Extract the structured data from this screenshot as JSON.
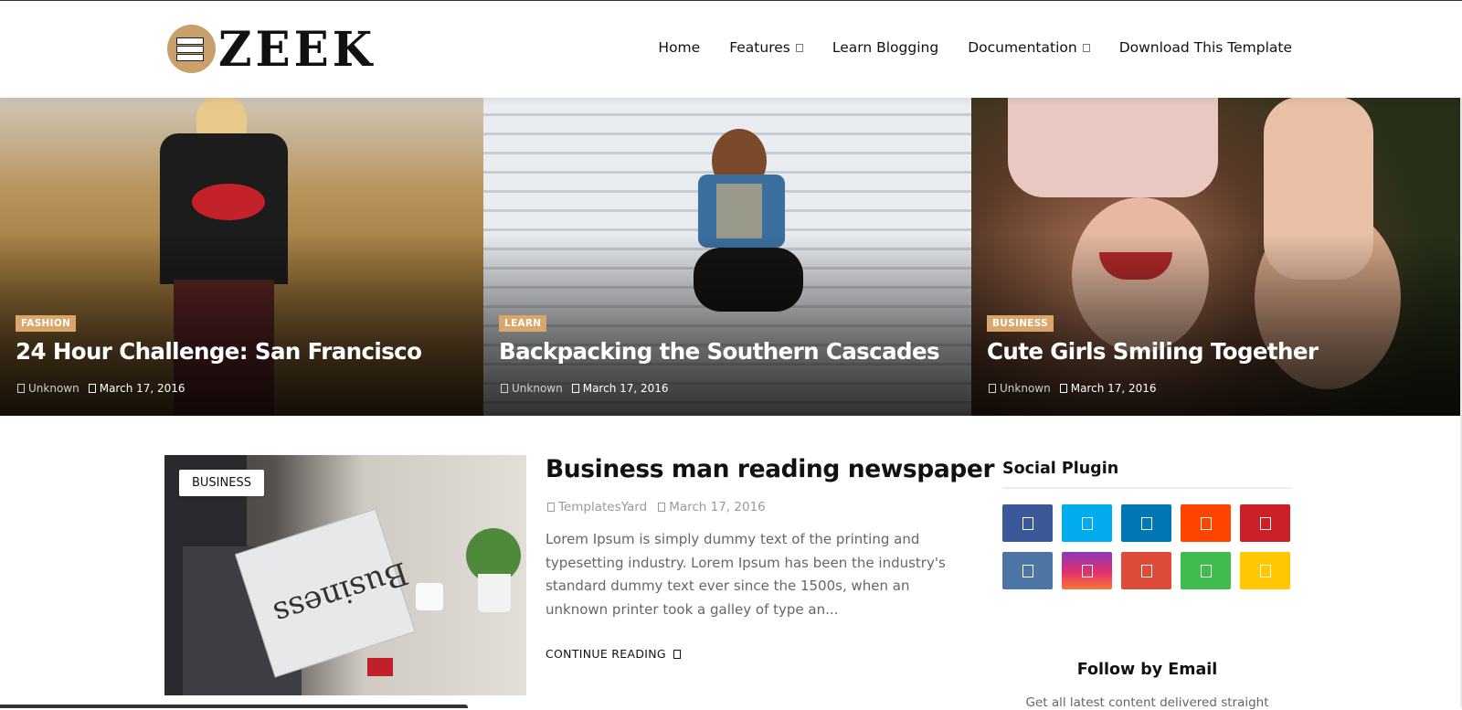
{
  "header": {
    "logo_text": "ZEEK",
    "nav": [
      {
        "label": "Home",
        "has_dropdown": false
      },
      {
        "label": "Features",
        "has_dropdown": true
      },
      {
        "label": "Learn Blogging",
        "has_dropdown": false
      },
      {
        "label": "Documentation",
        "has_dropdown": true
      },
      {
        "label": "Download This Template",
        "has_dropdown": false
      }
    ]
  },
  "hero": [
    {
      "category": "FASHION",
      "title": "24 Hour Challenge: San Francisco",
      "author": "Unknown",
      "date": "March 17, 2016"
    },
    {
      "category": "LEARN",
      "title": "Backpacking the Southern Cascades",
      "author": "Unknown",
      "date": "March 17, 2016"
    },
    {
      "category": "BUSINESS",
      "title": "Cute Girls Smiling Together",
      "author": "Unknown",
      "date": "March 17, 2016"
    }
  ],
  "featured_post": {
    "category": "BUSINESS",
    "thumb_word": "Business",
    "title": "Business man reading newspaper",
    "author": "TemplatesYard",
    "date": "March 17, 2016",
    "excerpt": "Lorem Ipsum is simply dummy text of the printing and typesetting industry. Lorem Ipsum has been the industry's standard dummy text ever since the 1500s, when an unknown printer took a galley of type an...",
    "continue_label": "CONTINUE READING"
  },
  "sidebar": {
    "social_title": "Social Plugin",
    "social_buttons": [
      {
        "icon": "facebook-icon",
        "color": "#3b5998"
      },
      {
        "icon": "twitter-icon",
        "color": "#00aced"
      },
      {
        "icon": "linkedin-icon",
        "color": "#0077b5"
      },
      {
        "icon": "reddit-icon",
        "color": "#ff4500"
      },
      {
        "icon": "pinterest-icon",
        "color": "#cb2027"
      },
      {
        "icon": "vk-icon",
        "color": "#4c75a3"
      },
      {
        "icon": "instagram-icon",
        "color": "#c13584"
      },
      {
        "icon": "google-plus-icon",
        "color": "#dd4b39"
      },
      {
        "icon": "whatsapp-icon",
        "color": "#3fbb50"
      },
      {
        "icon": "snapchat-icon",
        "color": "#ffc800"
      }
    ],
    "follow_title": "Follow by Email",
    "follow_subtitle": "Get all latest content delivered straight"
  },
  "colors": {
    "accent": "#d9a66b",
    "text": "#111111",
    "muted": "#666666"
  }
}
